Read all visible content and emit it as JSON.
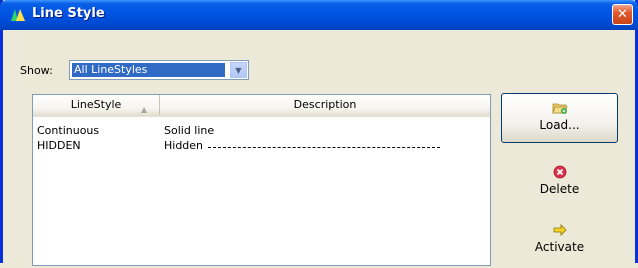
{
  "window": {
    "title": "Line Style",
    "close_glyph": "✕"
  },
  "filter": {
    "label": "Show:",
    "selected": "All LineStyles"
  },
  "table": {
    "columns": [
      "LineStyle",
      "Description"
    ],
    "rows": [
      {
        "name": "Continuous",
        "description": "Solid line"
      },
      {
        "name": "HIDDEN",
        "description": "Hidden"
      }
    ]
  },
  "buttons": {
    "load": "Load...",
    "delete": "Delete",
    "activate": "Activate"
  },
  "icons": {
    "app": "autocad-app-icon",
    "load": "folder-open-icon",
    "delete": "delete-x-icon",
    "activate": "arrow-right-icon"
  },
  "colors": {
    "titlebar": "#0054e3",
    "close": "#e2582b",
    "selection": "#316ac5"
  }
}
